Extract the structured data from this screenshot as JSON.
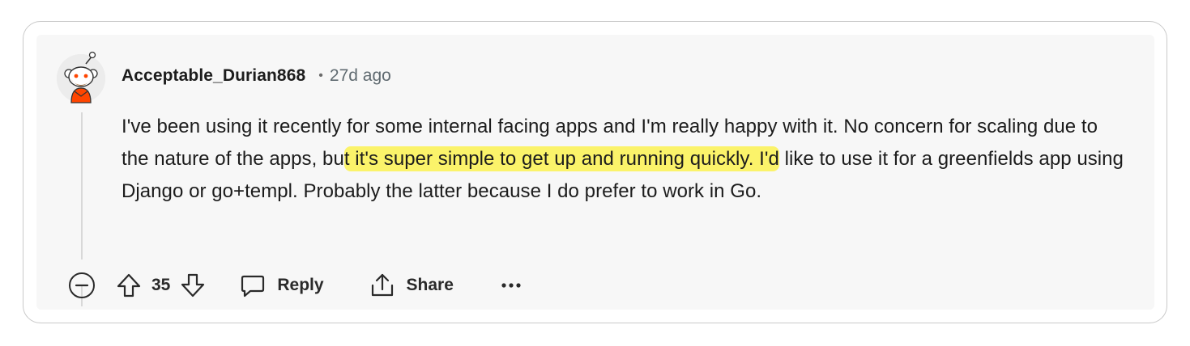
{
  "comment": {
    "username": "Acceptable_Durian868",
    "separator": "•",
    "timestamp": "27d ago",
    "body_before": "I've been using it recently for some internal facing apps and I'm really happy with it. No concern for scaling due to the nature of the apps, bu",
    "body_highlight": "t it's super simple to get up and running quickly. I'd",
    "body_after": " like to use it for a greenfields app using Django or go+templ. Probably the latter because I do prefer to work in Go.",
    "highlight_color": "#fbf36a"
  },
  "actions": {
    "collapse_icon": "minus-circle-icon",
    "upvote_icon": "arrow-up-icon",
    "score": "35",
    "downvote_icon": "arrow-down-icon",
    "reply_icon": "speech-bubble-icon",
    "reply_label": "Reply",
    "share_icon": "share-arrow-icon",
    "share_label": "Share",
    "more_icon": "ellipsis-icon",
    "more_label": "•••"
  },
  "avatar": {
    "icon": "snoo-avatar-icon",
    "accent": "#ff4500"
  }
}
